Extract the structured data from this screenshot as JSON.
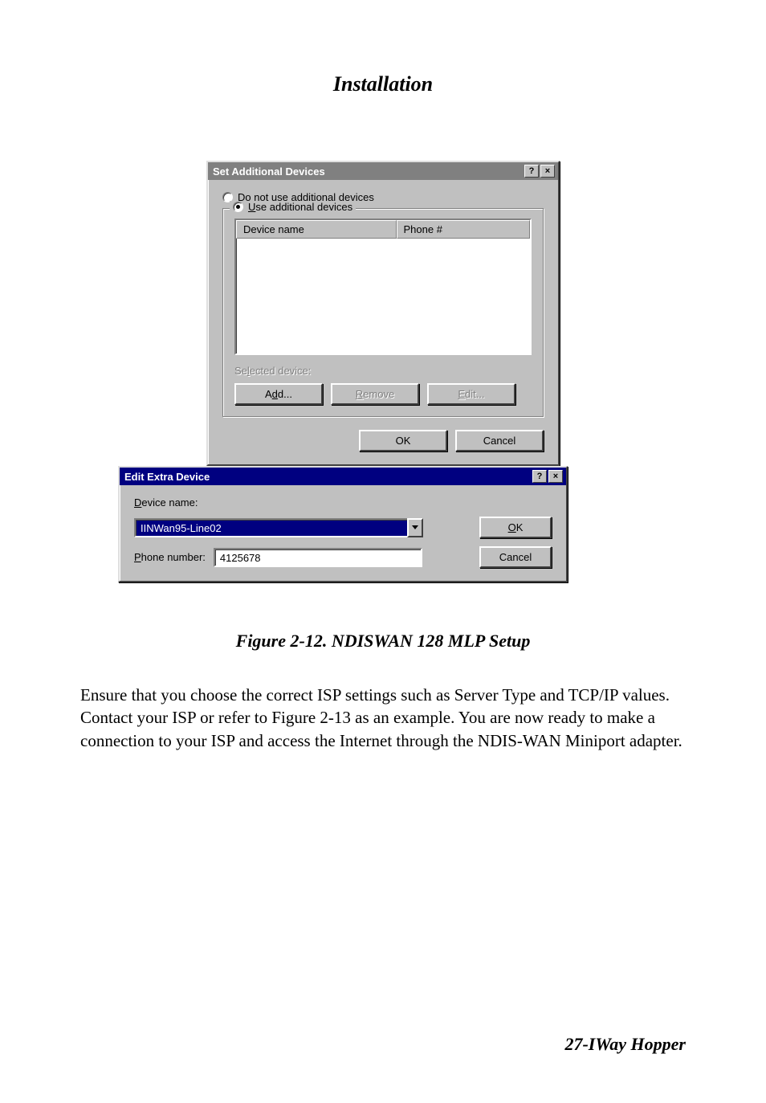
{
  "page_title": "Installation",
  "dialog1": {
    "title": "Set Additional Devices",
    "help_glyph": "?",
    "close_glyph": "×",
    "radio_not_use_before": "Do ",
    "radio_not_use_u": "n",
    "radio_not_use_after": "ot use additional devices",
    "radio_use_u": "U",
    "radio_use_after": "se additional devices",
    "col_device": "Device name",
    "col_phone": "Phone #",
    "selected_label_before": "Se",
    "selected_label_u": "l",
    "selected_label_after": "ected device:",
    "btn_add_before": "A",
    "btn_add_u": "d",
    "btn_add_after": "d...",
    "btn_remove_u": "R",
    "btn_remove_after": "emove",
    "btn_edit_u": "E",
    "btn_edit_after": "dit...",
    "btn_ok": "OK",
    "btn_cancel": "Cancel"
  },
  "dialog2": {
    "title": "Edit Extra Device",
    "help_glyph": "?",
    "close_glyph": "×",
    "device_label_u": "D",
    "device_label_after": "evice name:",
    "device_value": "IINWan95-Line02",
    "phone_label_u": "P",
    "phone_label_after": "hone number:",
    "phone_value": "4125678",
    "btn_ok_u": "O",
    "btn_ok_after": "K",
    "btn_cancel": "Cancel"
  },
  "figure_caption": "Figure 2-12. NDISWAN 128 MLP Setup",
  "body_text": "Ensure that you choose the correct ISP settings such as Server Type and TCP/IP values.  Contact your ISP or refer to Figure 2-13 as an example.  You are now ready to make a connection to your ISP and access the Internet through the NDIS-WAN Miniport adapter.",
  "footer": "27-IWay Hopper"
}
